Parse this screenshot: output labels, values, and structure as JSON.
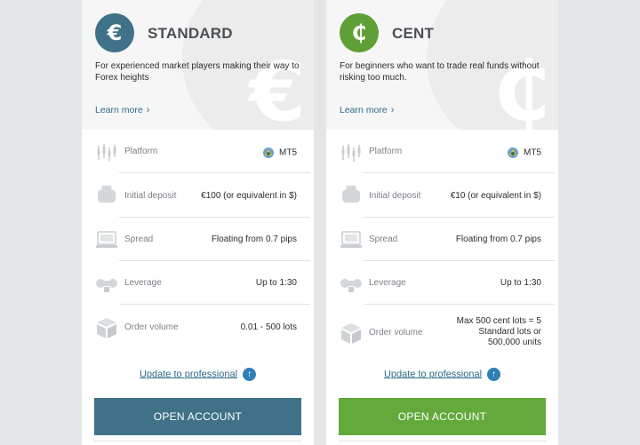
{
  "cards": [
    {
      "id": "standard",
      "icon_symbol": "€",
      "icon_name": "euro-icon",
      "title": "STANDARD",
      "description": "For experienced market players making their way to Forex heights",
      "learn_more": "Learn more",
      "rows": [
        {
          "icon": "platform-icon",
          "label": "Platform",
          "value": "MT5"
        },
        {
          "icon": "wallet-icon",
          "label": "Initial deposit",
          "value": "€100 (or equivalent in $)"
        },
        {
          "icon": "monitor-icon",
          "label": "Spread",
          "value": "Floating from 0.7 pips"
        },
        {
          "icon": "leverage-icon",
          "label": "Leverage",
          "value": "Up to 1:30"
        },
        {
          "icon": "box-icon",
          "label": "Order volume",
          "value": "0.01 - 500 lots"
        }
      ],
      "update_link": "Update to professional",
      "button": "OPEN ACCOUNT",
      "accent": "#3f7288"
    },
    {
      "id": "cent",
      "icon_symbol": "₵",
      "icon_name": "cent-icon",
      "title": "CENT",
      "description": "For beginners who want to trade real funds without risking too much.",
      "learn_more": "Learn more",
      "rows": [
        {
          "icon": "platform-icon",
          "label": "Platform",
          "value": "MT5"
        },
        {
          "icon": "wallet-icon",
          "label": "Initial deposit",
          "value": "€10 (or equivalent in $)"
        },
        {
          "icon": "monitor-icon",
          "label": "Spread",
          "value": "Floating from 0.7 pips"
        },
        {
          "icon": "leverage-icon",
          "label": "Leverage",
          "value": "Up to 1:30"
        },
        {
          "icon": "box-icon",
          "label": "Order volume",
          "value": "Max 500 cent lots = 5 Standard lots or 500,000 units"
        }
      ],
      "update_link": "Update to professional",
      "button": "OPEN ACCOUNT",
      "accent": "#64a93c"
    }
  ]
}
